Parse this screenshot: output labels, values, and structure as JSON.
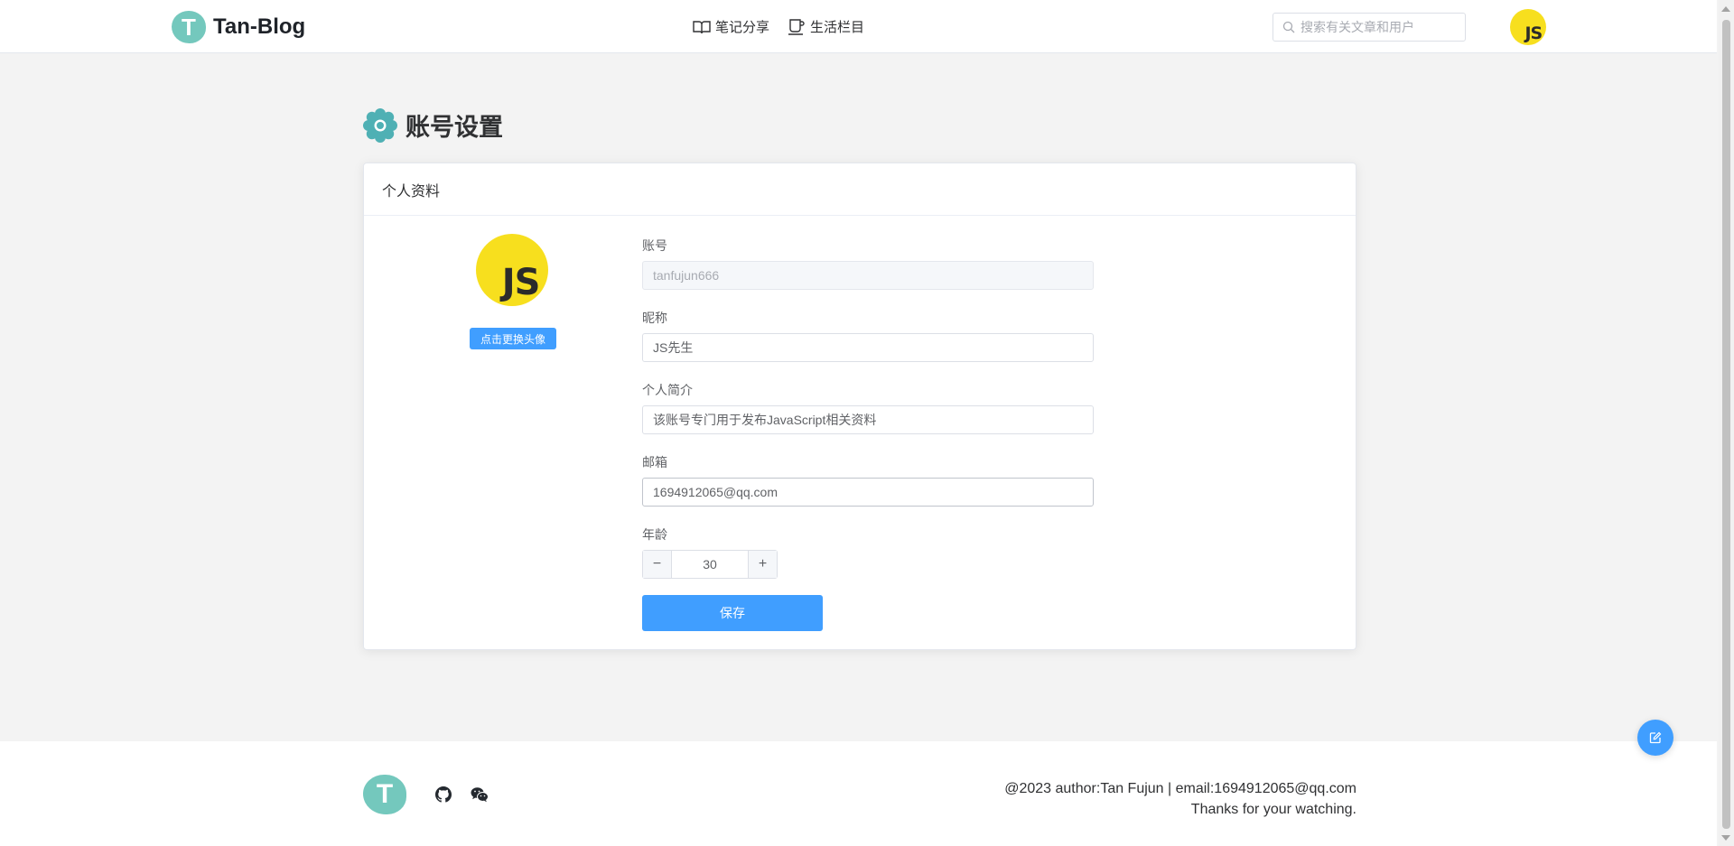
{
  "header": {
    "logo_letter": "T",
    "site_name": "Tan-Blog",
    "nav": [
      {
        "label": "笔记分享",
        "icon": "book-icon"
      },
      {
        "label": "生活栏目",
        "icon": "coffee-cup-icon"
      }
    ],
    "search_placeholder": "搜索有关文章和用户",
    "avatar_text": "JS"
  },
  "page": {
    "title": "账号设置",
    "title_icon": "gear-icon"
  },
  "card": {
    "header": "个人资料",
    "avatar_text": "JS",
    "change_avatar_label": "点击更换头像",
    "fields": {
      "account": {
        "label": "账号",
        "value": "tanfujun666"
      },
      "nickname": {
        "label": "昵称",
        "value": "JS先生"
      },
      "bio": {
        "label": "个人简介",
        "value": "该账号专门用于发布JavaScript相关资料"
      },
      "email": {
        "label": "邮箱",
        "value": "1694912065@qq.com"
      },
      "age": {
        "label": "年龄",
        "value": "30",
        "minus": "−",
        "plus": "+"
      }
    },
    "save_label": "保存"
  },
  "footer": {
    "logo_letter": "T",
    "icons": [
      "github-icon",
      "wechat-icon"
    ],
    "line1": "@2023 author:Tan Fujun | email:1694912065@qq.com",
    "line2": "Thanks for your watching."
  },
  "colors": {
    "accent": "#409eff",
    "logo": "#74c8bd",
    "js_yellow": "#f7df1e",
    "gear": "#4fb0b4"
  }
}
